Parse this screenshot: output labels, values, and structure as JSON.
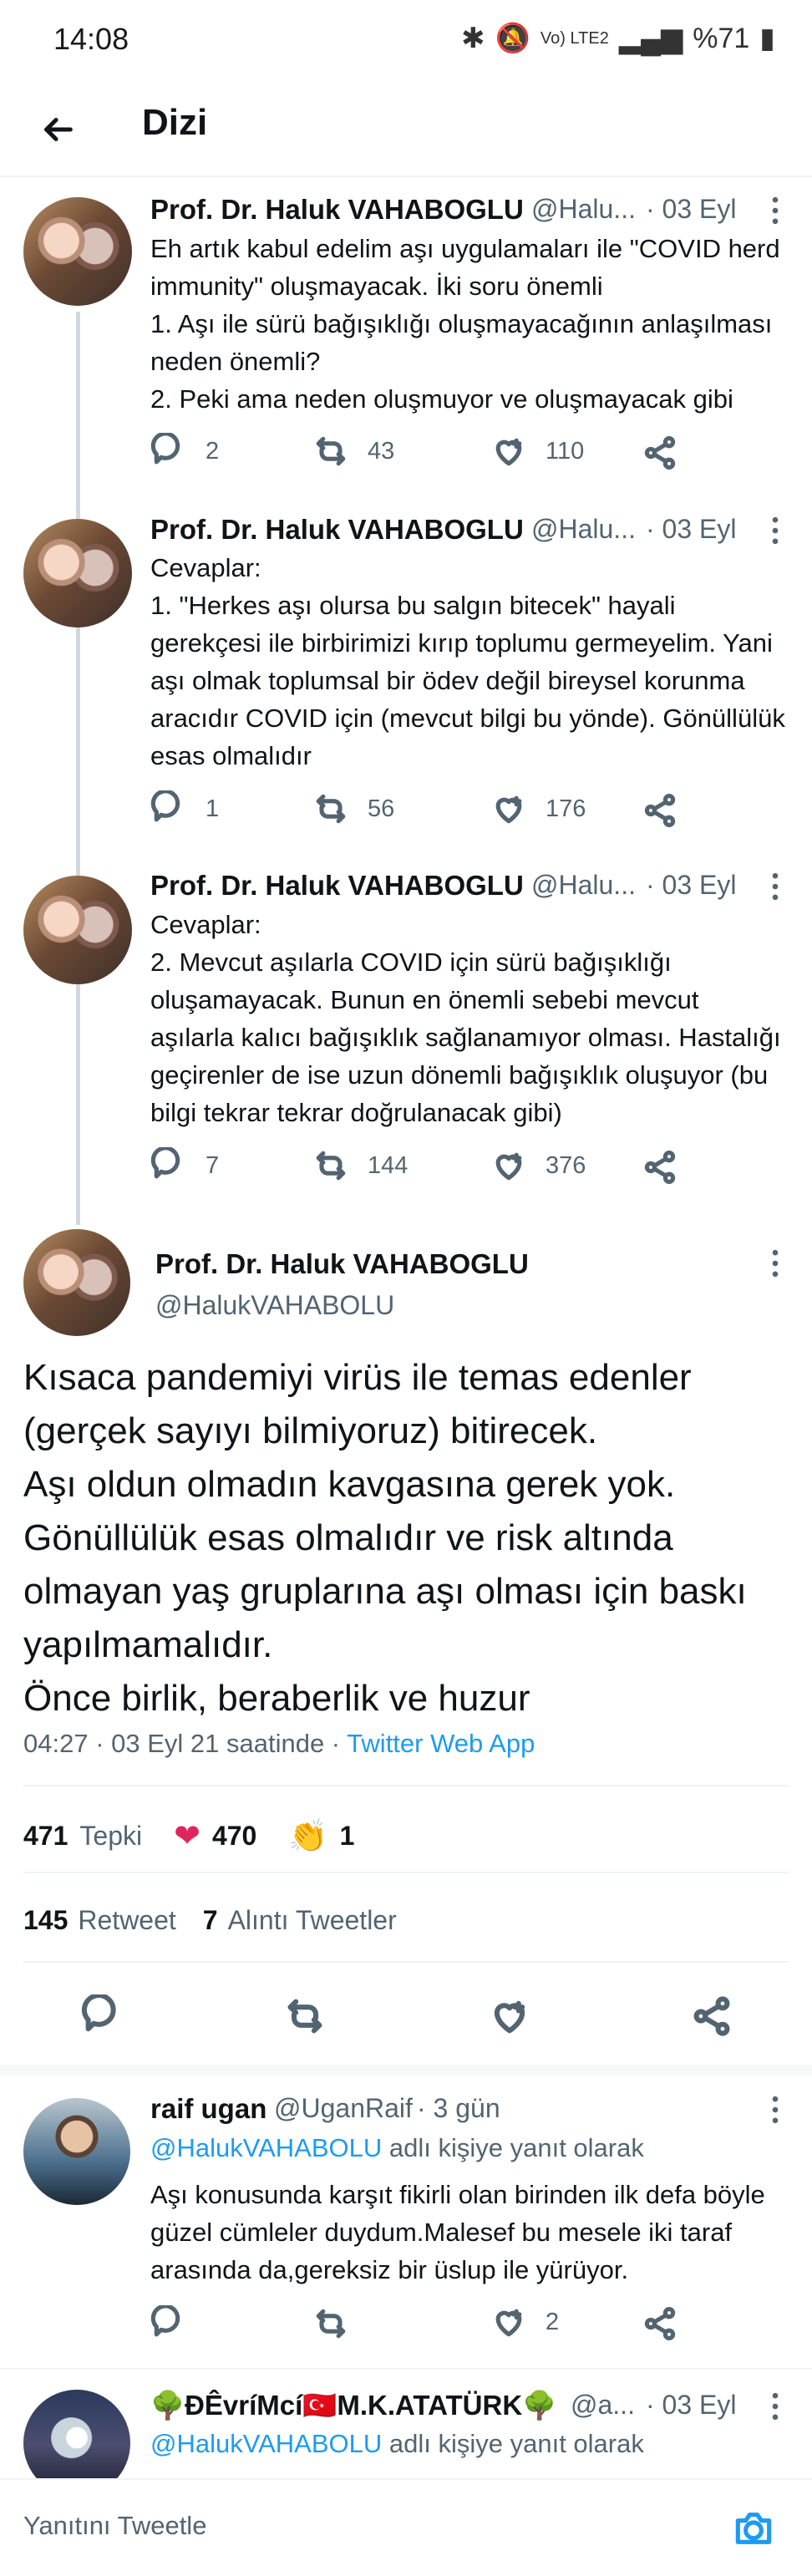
{
  "status": {
    "time": "14:08",
    "battery": "%71",
    "network": "Vo) LTE2"
  },
  "header": {
    "title": "Dizi"
  },
  "tweets": [
    {
      "name": "Prof. Dr. Haluk VAHABOGLU",
      "handle": "@Halu...",
      "date": "· 03 Eyl",
      "text": "Eh artık kabul edelim aşı uygulamaları ile \"COVID herd immunity\" oluşmayacak. İki soru önemli\n1. Aşı ile sürü bağışıklığı oluşmayacağının anlaşılması neden önemli?\n2. Peki ama neden oluşmuyor ve oluşmayacak gibi",
      "counts": {
        "reply": "2",
        "retweet": "43",
        "like": "110"
      }
    },
    {
      "name": "Prof. Dr. Haluk VAHABOGLU",
      "handle": "@Halu...",
      "date": "· 03 Eyl",
      "text": "Cevaplar:\n1. \"Herkes aşı olursa bu salgın bitecek\" hayali gerekçesi ile birbirimizi kırıp toplumu germeyelim. Yani aşı olmak toplumsal bir ödev değil bireysel korunma aracıdır COVID için (mevcut bilgi bu yönde). Gönüllülük esas olmalıdır",
      "counts": {
        "reply": "1",
        "retweet": "56",
        "like": "176"
      }
    },
    {
      "name": "Prof. Dr. Haluk VAHABOGLU",
      "handle": "@Halu...",
      "date": "· 03 Eyl",
      "text": "Cevaplar:\n2. Mevcut aşılarla COVID için sürü bağışıklığı oluşamayacak. Bunun en önemli sebebi mevcut aşılarla kalıcı bağışıklık sağlanamıyor olması. Hastalığı geçirenler de ise uzun dönemli bağışıklık oluşuyor (bu bilgi tekrar tekrar doğrulanacak gibi)",
      "counts": {
        "reply": "7",
        "retweet": "144",
        "like": "376"
      }
    }
  ],
  "main_tweet": {
    "name": "Prof. Dr. Haluk VAHABOGLU",
    "handle": "@HalukVAHABOLU",
    "text": "Kısaca pandemiyi virüs ile temas edenler (gerçek sayıyı bilmiyoruz) bitirecek.\nAşı oldun olmadın kavgasına gerek yok. Gönüllülük esas olmalıdır ve risk altında olmayan yaş gruplarına aşı olması için baskı yapılmamalıdır.\nÖnce birlik, beraberlik ve huzur",
    "time": "04:27 · 03 Eyl 21 saatinde · ",
    "source": "Twitter Web App",
    "reactions": {
      "total": "471",
      "total_label": "Tepki",
      "heart": "470",
      "clap": "1"
    },
    "retweets": "145",
    "retweets_label": "Retweet",
    "quotes": "7",
    "quotes_label": "Alıntı Tweetler"
  },
  "replies": [
    {
      "name": "raif ugan",
      "handle": "@UganRaif",
      "date": "· 3 gün",
      "replying_to": "@HalukVAHABOLU",
      "replying_suffix": "adlı kişiye yanıt olarak",
      "text": "Aşı konusunda karşıt fikirli olan birinden ilk defa böyle güzel cümleler duydum.Malesef bu mesele iki taraf arasında da,gereksiz bir üslup ile yürüyor.",
      "likes": "2"
    },
    {
      "name": "🌳ĐÊvríMcí🇹🇷M.K.ATATÜRK🌳",
      "handle": "@a...",
      "date": "· 03 Eyl",
      "replying_to": "@HalukVAHABOLU",
      "replying_suffix": "adlı kişiye yanıt olarak"
    }
  ],
  "compose": {
    "placeholder": "Yanıtını Tweetle"
  },
  "icons": {
    "back": "arrow-left-icon",
    "more": "more-vertical-icon",
    "reply": "reply-icon",
    "retweet": "retweet-icon",
    "like": "like-icon",
    "share": "share-icon",
    "camera": "camera-icon"
  }
}
